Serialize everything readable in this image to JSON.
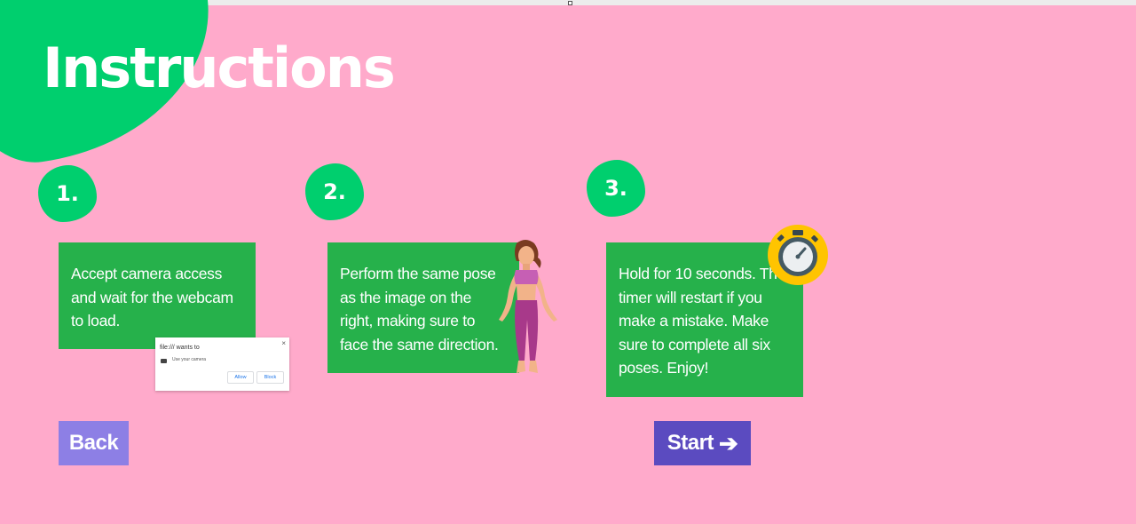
{
  "title": "Instructions",
  "steps": [
    {
      "number": "1.",
      "text": "Accept camera access and wait for the webcam to load."
    },
    {
      "number": "2.",
      "text": "Perform the same pose as the image on the right, making sure to face the same direction."
    },
    {
      "number": "3.",
      "text": "Hold for 10 seconds. The timer will restart if you make a mistake. Make sure to complete all six poses. Enjoy!"
    }
  ],
  "permission_popup": {
    "title": "file:/// wants to",
    "permission": "Use your camera",
    "allow": "Allow",
    "block": "Block"
  },
  "buttons": {
    "back": "Back",
    "start": "Start",
    "start_icon": "right-arrow-icon"
  },
  "icons": {
    "pose_figure": "woman-pose-icon",
    "timer": "stopwatch-icon"
  },
  "colors": {
    "background": "#ffaacb",
    "accent_green": "#00cf6e",
    "card_green": "#26b14b",
    "back_button": "#8d7fe5",
    "start_button": "#5b4bc0"
  }
}
